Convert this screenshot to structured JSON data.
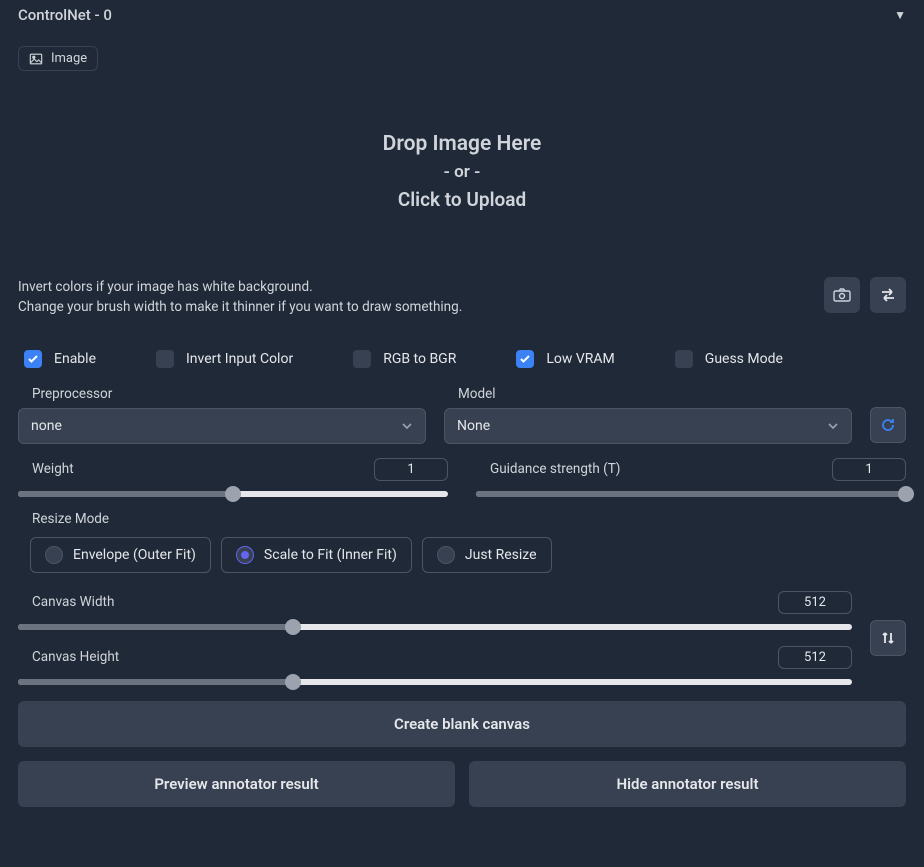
{
  "header": {
    "title": "ControlNet - 0"
  },
  "tab": {
    "label": "Image"
  },
  "dropzone": {
    "line1": "Drop Image Here",
    "line2": "- or -",
    "line3": "Click to Upload"
  },
  "hint": {
    "line1": "Invert colors if your image has white background.",
    "line2": "Change your brush width to make it thinner if you want to draw something."
  },
  "checks": {
    "enable": "Enable",
    "invert": "Invert Input Color",
    "rgb": "RGB to BGR",
    "lowvram": "Low VRAM",
    "guess": "Guess Mode"
  },
  "preprocessor": {
    "label": "Preprocessor",
    "value": "none"
  },
  "model": {
    "label": "Model",
    "value": "None"
  },
  "weight": {
    "label": "Weight",
    "value": "1"
  },
  "guidance": {
    "label": "Guidance strength (T)",
    "value": "1"
  },
  "resize": {
    "label": "Resize Mode",
    "envelope": "Envelope (Outer Fit)",
    "scale": "Scale to Fit (Inner Fit)",
    "just": "Just Resize"
  },
  "canvasW": {
    "label": "Canvas Width",
    "value": "512"
  },
  "canvasH": {
    "label": "Canvas Height",
    "value": "512"
  },
  "buttons": {
    "blank": "Create blank canvas",
    "preview": "Preview annotator result",
    "hide": "Hide annotator result"
  }
}
